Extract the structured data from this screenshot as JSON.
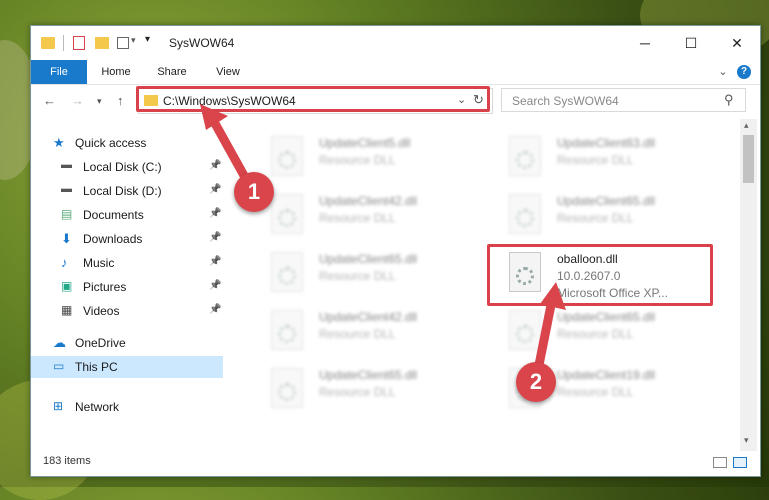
{
  "window": {
    "title": "SysWOW64",
    "minimize_glyph": "─",
    "maximize_glyph": "☐",
    "close_glyph": "✕"
  },
  "ribbon": {
    "tabs": [
      "File",
      "Home",
      "Share",
      "View"
    ],
    "expand_glyph": "⌄",
    "help_glyph": "?"
  },
  "navbar": {
    "address": "C:\\Windows\\SysWOW64",
    "search_placeholder": "Search SysWOW64"
  },
  "sidebar": {
    "items": [
      {
        "label": "Quick access",
        "icon": "star-icon",
        "pinned": false
      },
      {
        "label": "Local Disk (C:)",
        "icon": "drive-icon",
        "pinned": true
      },
      {
        "label": "Local Disk (D:)",
        "icon": "drive-icon",
        "pinned": true
      },
      {
        "label": "Documents",
        "icon": "documents-icon",
        "pinned": true
      },
      {
        "label": "Downloads",
        "icon": "download-icon",
        "pinned": true
      },
      {
        "label": "Music",
        "icon": "music-icon",
        "pinned": true
      },
      {
        "label": "Pictures",
        "icon": "pictures-icon",
        "pinned": true
      },
      {
        "label": "Videos",
        "icon": "videos-icon",
        "pinned": true
      },
      {
        "label": "OneDrive",
        "icon": "cloud-icon",
        "pinned": false
      },
      {
        "label": "This PC",
        "icon": "computer-icon",
        "pinned": false,
        "selected": true
      },
      {
        "label": "Network",
        "icon": "network-icon",
        "pinned": false
      }
    ]
  },
  "files": [
    {
      "name": "UpdateClient5.dll",
      "type": "Resource DLL",
      "blurred": true
    },
    {
      "name": "UpdateClient63.dll",
      "type": "Resource DLL",
      "blurred": true
    },
    {
      "name": "UpdateClient42.dll",
      "type": "Resource DLL",
      "blurred": true
    },
    {
      "name": "UpdateClient65.dll",
      "type": "Resource DLL",
      "blurred": true
    },
    {
      "name": "UpdateClient65.dll",
      "type": "Resource DLL",
      "blurred": true
    },
    {
      "name": "oballoon.dll",
      "version": "10.0.2607.0",
      "company": "Microsoft Office XP...",
      "blurred": false,
      "highlighted": true
    },
    {
      "name": "UpdateClient42.dll",
      "type": "Resource DLL",
      "blurred": true
    },
    {
      "name": "UpdateClient65.dll",
      "type": "Resource DLL",
      "blurred": true
    },
    {
      "name": "UpdateClient65.dll",
      "type": "Resource DLL",
      "blurred": true
    },
    {
      "name": "UpdateClient19.dll",
      "type": "Resource DLL",
      "blurred": true
    }
  ],
  "status": {
    "item_count": "183 items"
  },
  "callouts": [
    "1",
    "2"
  ],
  "colors": {
    "accent": "#1979ca",
    "highlight": "#d9424a",
    "selection": "#cce8ff"
  }
}
